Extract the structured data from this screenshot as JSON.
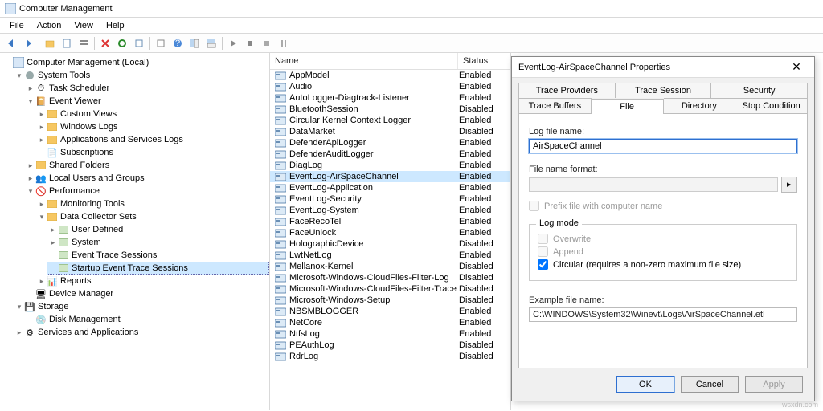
{
  "window": {
    "title": "Computer Management"
  },
  "menu": {
    "file": "File",
    "action": "Action",
    "view": "View",
    "help": "Help"
  },
  "toolbar_icons": [
    "back",
    "forward",
    "up",
    "page",
    "list",
    "delete",
    "refresh",
    "export",
    "props",
    "help",
    "pane1",
    "pane2",
    "play",
    "rec",
    "stop",
    "pause"
  ],
  "tree": {
    "root": "Computer Management (Local)",
    "system_tools": "System Tools",
    "task_scheduler": "Task Scheduler",
    "event_viewer": "Event Viewer",
    "custom_views": "Custom Views",
    "windows_logs": "Windows Logs",
    "app_svc_logs": "Applications and Services Logs",
    "subscriptions": "Subscriptions",
    "shared_folders": "Shared Folders",
    "local_users": "Local Users and Groups",
    "performance": "Performance",
    "monitoring_tools": "Monitoring Tools",
    "data_collector_sets": "Data Collector Sets",
    "user_defined": "User Defined",
    "system": "System",
    "event_trace_sessions": "Event Trace Sessions",
    "startup_event_trace": "Startup Event Trace Sessions",
    "reports": "Reports",
    "device_manager": "Device Manager",
    "storage": "Storage",
    "disk_management": "Disk Management",
    "services_apps": "Services and Applications"
  },
  "list": {
    "cols": {
      "name": "Name",
      "status": "Status"
    },
    "rows": [
      {
        "name": "AppModel",
        "status": "Enabled"
      },
      {
        "name": "Audio",
        "status": "Enabled"
      },
      {
        "name": "AutoLogger-Diagtrack-Listener",
        "status": "Enabled"
      },
      {
        "name": "BluetoothSession",
        "status": "Disabled"
      },
      {
        "name": "Circular Kernel Context Logger",
        "status": "Enabled"
      },
      {
        "name": "DataMarket",
        "status": "Disabled"
      },
      {
        "name": "DefenderApiLogger",
        "status": "Enabled"
      },
      {
        "name": "DefenderAuditLogger",
        "status": "Enabled"
      },
      {
        "name": "DiagLog",
        "status": "Enabled"
      },
      {
        "name": "EventLog-AirSpaceChannel",
        "status": "Enabled",
        "selected": true
      },
      {
        "name": "EventLog-Application",
        "status": "Enabled"
      },
      {
        "name": "EventLog-Security",
        "status": "Enabled"
      },
      {
        "name": "EventLog-System",
        "status": "Enabled"
      },
      {
        "name": "FaceRecoTel",
        "status": "Enabled"
      },
      {
        "name": "FaceUnlock",
        "status": "Enabled"
      },
      {
        "name": "HolographicDevice",
        "status": "Disabled"
      },
      {
        "name": "LwtNetLog",
        "status": "Enabled"
      },
      {
        "name": "Mellanox-Kernel",
        "status": "Disabled"
      },
      {
        "name": "Microsoft-Windows-CloudFiles-Filter-Log",
        "status": "Disabled"
      },
      {
        "name": "Microsoft-Windows-CloudFiles-Filter-Trace",
        "status": "Disabled"
      },
      {
        "name": "Microsoft-Windows-Setup",
        "status": "Disabled"
      },
      {
        "name": "NBSMBLOGGER",
        "status": "Enabled"
      },
      {
        "name": "NetCore",
        "status": "Enabled"
      },
      {
        "name": "NtfsLog",
        "status": "Enabled"
      },
      {
        "name": "PEAuthLog",
        "status": "Disabled"
      },
      {
        "name": "RdrLog",
        "status": "Disabled"
      }
    ]
  },
  "dialog": {
    "title": "EventLog-AirSpaceChannel Properties",
    "tabs_row1": [
      "Trace Providers",
      "Trace Session",
      "Security"
    ],
    "tabs_row2": [
      "Trace Buffers",
      "File",
      "Directory",
      "Stop Condition"
    ],
    "active_tab": "File",
    "log_file_name_label": "Log file name:",
    "log_file_name_value": "AirSpaceChannel",
    "file_name_format_label": "File name format:",
    "file_name_format_value": "",
    "prefix_label": "Prefix file with computer name",
    "log_mode_title": "Log mode",
    "overwrite_label": "Overwrite",
    "append_label": "Append",
    "circular_label": "Circular (requires a non-zero maximum file size)",
    "example_label": "Example file name:",
    "example_value": "C:\\WINDOWS\\System32\\Winevt\\Logs\\AirSpaceChannel.etl",
    "buttons": {
      "ok": "OK",
      "cancel": "Cancel",
      "apply": "Apply"
    }
  },
  "watermark": "wsxdn.com"
}
